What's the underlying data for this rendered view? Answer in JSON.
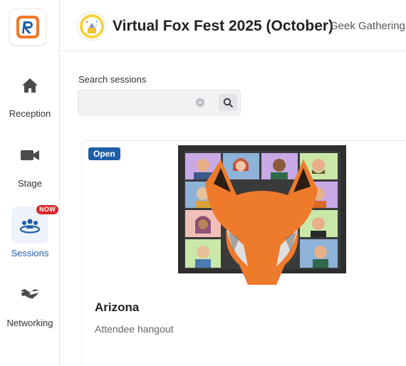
{
  "sidebar": {
    "items": [
      {
        "label": "Reception",
        "icon": "home-icon",
        "active": false
      },
      {
        "label": "Stage",
        "icon": "video-camera-icon",
        "active": false
      },
      {
        "label": "Sessions",
        "icon": "people-group-icon",
        "active": true,
        "badge": "NOW"
      },
      {
        "label": "Networking",
        "icon": "handshake-icon",
        "active": false
      }
    ]
  },
  "header": {
    "event_title": "Virtual Fox Fest 2025 (October)",
    "organizer": "Geek Gathering"
  },
  "search": {
    "label": "Search sessions",
    "value": "",
    "placeholder": ""
  },
  "session_card": {
    "status": "Open",
    "title": "Arizona",
    "description": "Attendee hangout"
  },
  "colors": {
    "accent": "#1f5fa8",
    "badge_red": "#d9262d",
    "fox_orange": "#ee7a2c"
  }
}
